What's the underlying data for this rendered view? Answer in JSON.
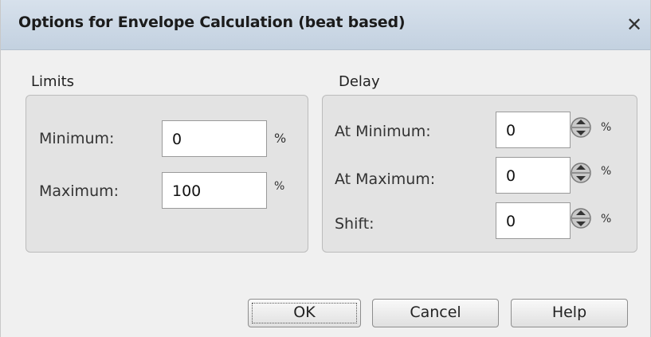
{
  "window": {
    "title": "Options for Envelope Calculation (beat based)",
    "close_glyph": "✕"
  },
  "limits": {
    "label": "Limits",
    "minimum": {
      "label": "Minimum:",
      "value": "0",
      "unit": "%"
    },
    "maximum": {
      "label": "Maximum:",
      "value": "100",
      "unit": "%"
    }
  },
  "delay": {
    "label": "Delay",
    "at_minimum": {
      "label": "At Minimum:",
      "value": "0",
      "unit": "%"
    },
    "at_maximum": {
      "label": "At Maximum:",
      "value": "0",
      "unit": "%"
    },
    "shift": {
      "label": "Shift:",
      "value": "0",
      "unit": "%"
    }
  },
  "buttons": {
    "ok": "OK",
    "cancel": "Cancel",
    "help": "Help"
  },
  "icons": {
    "spinner": "spinner-updown-icon",
    "close": "close-icon"
  }
}
